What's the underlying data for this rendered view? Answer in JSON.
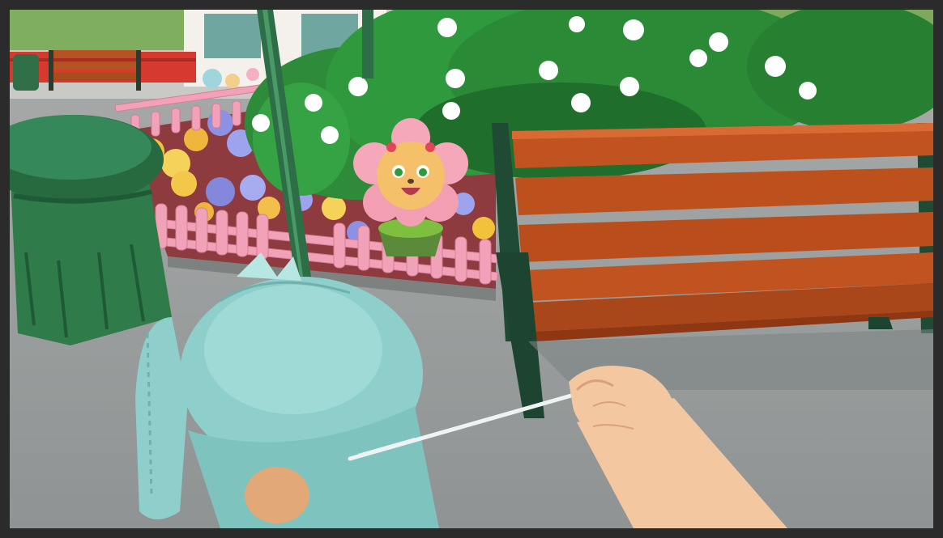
{
  "scene": {
    "setting": "",
    "colors": {
      "frame": "#2b2b2b",
      "pavement": "#9a9e9e",
      "pavement_light": "#b6b8b6",
      "bush": "#2f8f3a",
      "bush_dark": "#1e6a2b",
      "flower_white": "#ffffff",
      "fence_pink": "#f2a2b8",
      "bench_wood": "#c0531f",
      "bench_wood_dark": "#8f3612",
      "bench_metal": "#1f4a33",
      "trash_can": "#2f7b4a",
      "lamp_post": "#2e6e47",
      "plush": "#8fcfcb",
      "plush_dark": "#6fb1ad",
      "hand_skin": "#f3c7a0",
      "string": "#e8eeee",
      "flower_char_petal": "#f6a8bb",
      "flower_char_face": "#f4c16a"
    },
    "icons": [
      "trash-can-icon",
      "bench-icon",
      "plush-bunny-icon",
      "flower-character-icon",
      "hand-icon"
    ]
  }
}
